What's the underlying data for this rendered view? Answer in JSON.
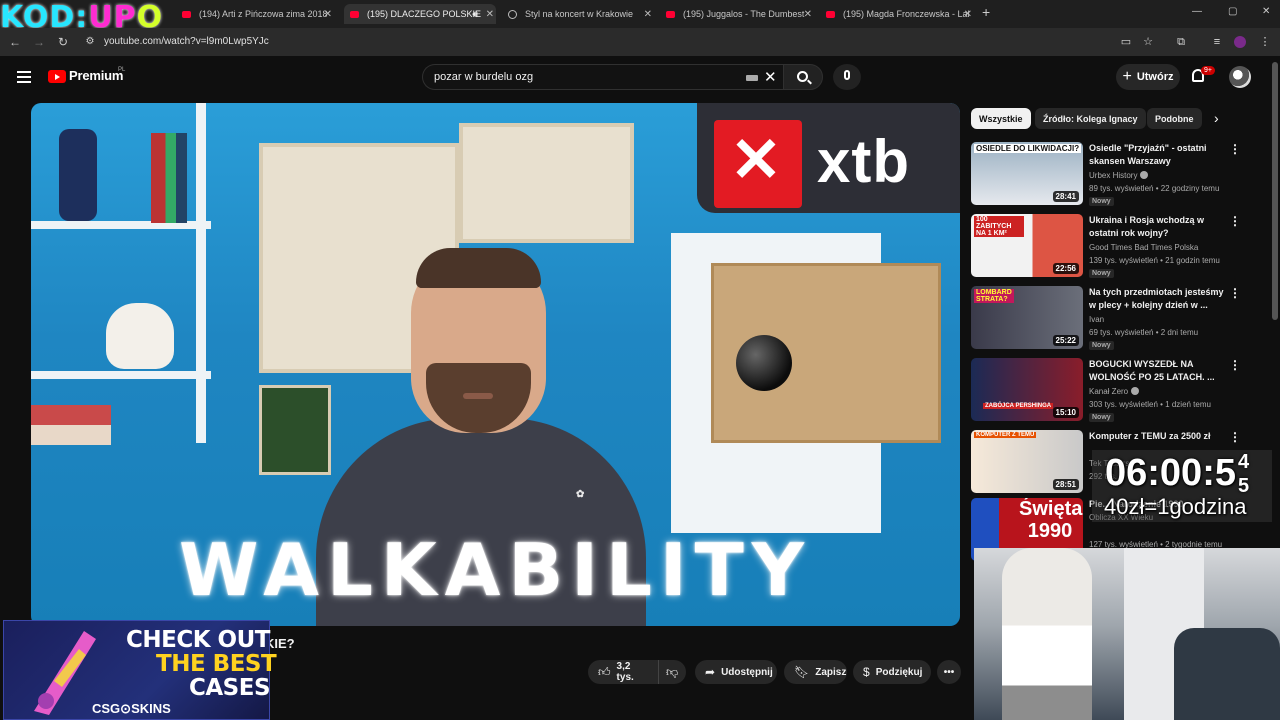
{
  "overlay_logo": {
    "a": "KOD:",
    "b": "UP",
    "c": "O"
  },
  "tabs": [
    {
      "label": "(194) Arti z Pińczowa zima 2018",
      "icon": "youtube-icon"
    },
    {
      "label": "(195) DLACZEGO POLSKIE",
      "icon": "youtube-icon",
      "active": true
    },
    {
      "label": "Styl na koncert w Krakowie",
      "icon": "globe-icon"
    },
    {
      "label": "(195) Juggalos - The Dumbest",
      "icon": "youtube-icon"
    },
    {
      "label": "(195) Magda Fronczewska - Lal",
      "icon": "youtube-icon"
    }
  ],
  "address": {
    "url": "youtube.com/watch?v=l9m0Lwp5YJc"
  },
  "header": {
    "logo_text": "Premium",
    "country": "PL",
    "search_value": "pozar w burdelu ozg",
    "create_label": "Utwórz",
    "notif_count": "9+"
  },
  "video": {
    "overlay_text": "WALKABILITY",
    "sponsor": "xtb",
    "title_tail": "KIE?",
    "likes": "3,2 tys.",
    "share": "Udostępnij",
    "save": "Zapisz",
    "thanks": "Podziękuj"
  },
  "chips": [
    "Wszystkie",
    "Źródło: Kolega Ignacy",
    "Podobne"
  ],
  "recommendations": [
    {
      "title": "Osiedle \"Przyjaźń\" - ostatni skansen Warszawy",
      "channel": "Urbex History",
      "verified": true,
      "meta": "89 tys. wyświetleń • 22 godziny temu",
      "badge": "Nowy",
      "duration": "28:41",
      "thumb_text": "OSIEDLE DO LIKWIDACJI?"
    },
    {
      "title": "Ukraina i Rosja wchodzą w ostatni rok wojny?",
      "channel": "Good Times Bad Times Polska",
      "verified": false,
      "meta": "139 tys. wyświetleń • 21 godzin temu",
      "badge": "Nowy",
      "duration": "22:56",
      "thumb_text": "100 ZABITYCH NA 1 KM²"
    },
    {
      "title": "Na tych przedmiotach jesteśmy w plecy + kolejny dzień w ...",
      "channel": "Ivan",
      "verified": false,
      "meta": "69 tys. wyświetleń • 2 dni temu",
      "badge": "Nowy",
      "duration": "25:22",
      "thumb_text": "LOMBARD STRATA?"
    },
    {
      "title": "BOGUCKI WYSZEDŁ NA WOLNOŚĆ PO 25 LATACH. ...",
      "channel": "Kanał Zero",
      "verified": true,
      "meta": "303 tys. wyświetleń • 1 dzień temu",
      "badge": "Nowy",
      "duration": "15:10",
      "thumb_text": "ZABÓJCA PERSHINGA"
    },
    {
      "title": "Komputer z TEMU za 2500 zł",
      "channel": "Tek Testers",
      "verified": false,
      "meta": "292 tys.",
      "badge": "",
      "duration": "28:51",
      "thumb_text": "KOMPUTER Z TEMU"
    },
    {
      "title": "Pie... Narodzenie 1990",
      "channel": "Oblicza XX Wieku",
      "verified": false,
      "meta": "127 tys. wyświetleń • 2 tygodnie temu",
      "badge": "",
      "duration": "",
      "thumb_text": "Święta 1990"
    }
  ],
  "stream": {
    "timer": "06:00:5",
    "timer_side": "4\n5",
    "rate": "40zł=1godzina"
  },
  "ad": {
    "line1": "CHECK OUT",
    "line2": "THE BEST",
    "line3": "CASES",
    "brand": "CSG⊙SKINS"
  },
  "colors": {
    "accent": "#ff0000",
    "bg": "#0f0f0f",
    "chip_bg": "#272727"
  }
}
